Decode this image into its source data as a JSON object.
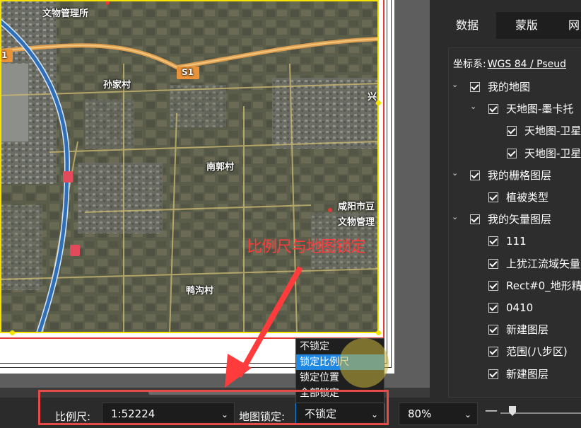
{
  "map": {
    "labels": {
      "top_left": "文物管理所",
      "sunjiacun": "孙家村",
      "s1_badge": "S1",
      "s1_left": "1",
      "xing": "兴",
      "nanguocun": "南郭村",
      "xianyang_1": "咸阳市豆",
      "xianyang_2": "文物管理",
      "yagoucun": "鸭沟村"
    }
  },
  "annotation": {
    "text": "比例尺与地图锁定"
  },
  "lock_menu": {
    "options": [
      "不锁定",
      "锁定比例尺",
      "锁定位置",
      "全部锁定"
    ],
    "selected_index": 1
  },
  "status_bar": {
    "scale_label": "比例尺:",
    "scale_value": "1:52224",
    "lock_label": "地图锁定:",
    "lock_value": "不锁定",
    "zoom_value": "80%",
    "zoom_minus": "—"
  },
  "right_panel": {
    "tabs": [
      "数据",
      "蒙版",
      "网"
    ],
    "crs_label": "坐标系:",
    "crs_value": "WGS 84 / Pseud",
    "tree": [
      {
        "label": "我的地图",
        "level": 0,
        "expander": true
      },
      {
        "label": "天地图-墨卡托",
        "level": 1,
        "expander": true
      },
      {
        "label": "天地图-卫星",
        "level": 2,
        "expander": false
      },
      {
        "label": "天地图-卫星",
        "level": 2,
        "expander": false
      },
      {
        "label": "我的栅格图层",
        "level": 0,
        "expander": true
      },
      {
        "label": "植被类型",
        "level": 1,
        "expander": false
      },
      {
        "label": "我的矢量图层",
        "level": 0,
        "expander": true
      },
      {
        "label": "111",
        "level": 1,
        "expander": false
      },
      {
        "label": "上犹江流域矢量",
        "level": 1,
        "expander": false
      },
      {
        "label": "Rect#0_地形精",
        "level": 1,
        "expander": false
      },
      {
        "label": "0410",
        "level": 1,
        "expander": false
      },
      {
        "label": "新建图层",
        "level": 1,
        "expander": false
      },
      {
        "label": "范围(八步区)",
        "level": 1,
        "expander": false
      },
      {
        "label": "新建图层",
        "level": 1,
        "expander": false
      }
    ]
  },
  "icons": {
    "expander": "chevron-down-icon",
    "dropdown": "chevron-down-icon",
    "checkbox": "checkbox-checked-icon"
  },
  "colors": {
    "selection_border": "#f5e300",
    "annotation_red": "#ff3b3b",
    "menu_highlight": "#1e88e5",
    "road_orange": "#e0a050"
  }
}
